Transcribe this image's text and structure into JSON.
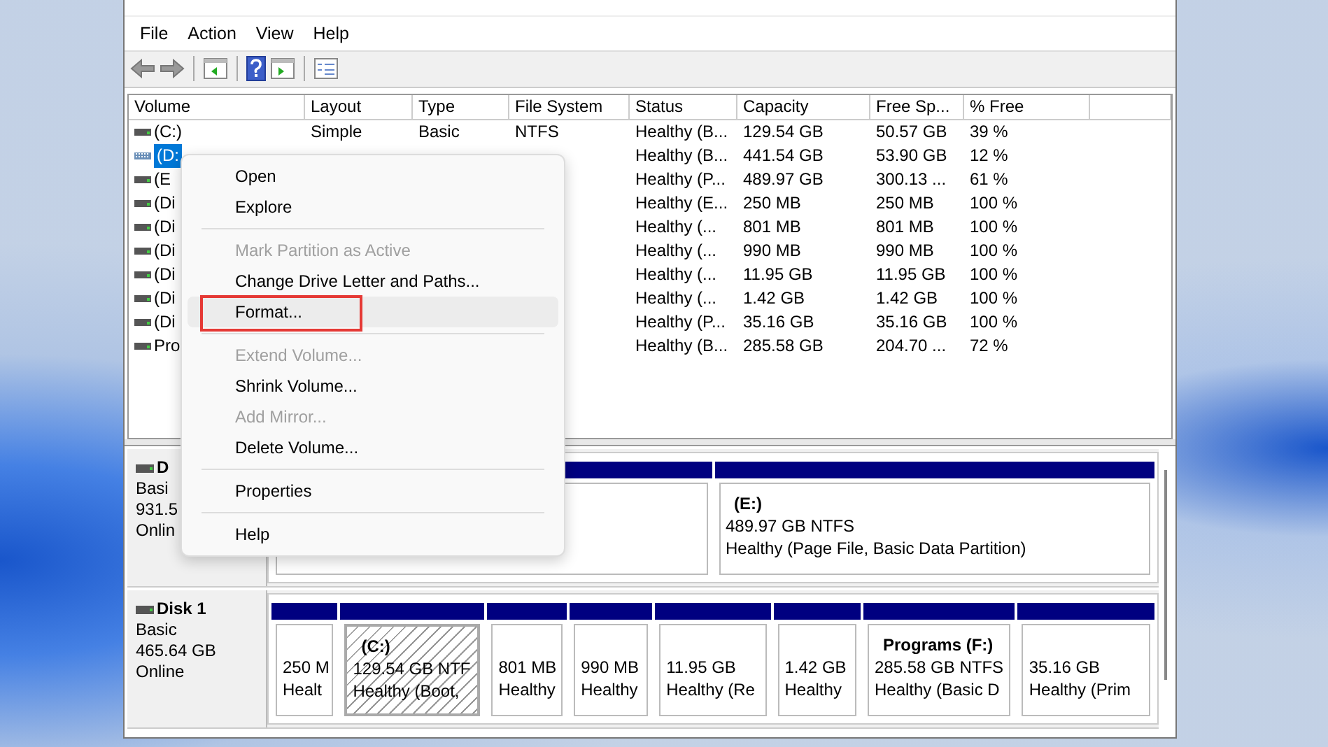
{
  "menu_bar": [
    "File",
    "Action",
    "View",
    "Help"
  ],
  "volume_list": {
    "columns": [
      "Volume",
      "Layout",
      "Type",
      "File System",
      "Status",
      "Capacity",
      "Free Sp...",
      "% Free"
    ],
    "rows": [
      {
        "selected": false,
        "cells": [
          "(C:)",
          "Simple",
          "Basic",
          "NTFS",
          "Healthy (B...",
          "129.54 GB",
          "50.57 GB",
          "39 %"
        ]
      },
      {
        "selected": true,
        "cells": [
          "(D:",
          "",
          "",
          "",
          "Healthy (B...",
          "441.54 GB",
          "53.90 GB",
          "12 %"
        ]
      },
      {
        "selected": false,
        "cells": [
          "(E",
          "",
          "",
          "",
          "Healthy (P...",
          "489.97 GB",
          "300.13 ...",
          "61 %"
        ]
      },
      {
        "selected": false,
        "cells": [
          "(Di",
          "",
          "",
          "",
          "Healthy (E...",
          "250 MB",
          "250 MB",
          "100 %"
        ]
      },
      {
        "selected": false,
        "cells": [
          "(Di",
          "",
          "",
          "",
          "Healthy (...",
          "801 MB",
          "801 MB",
          "100 %"
        ]
      },
      {
        "selected": false,
        "cells": [
          "(Di",
          "",
          "",
          "",
          "Healthy (...",
          "990 MB",
          "990 MB",
          "100 %"
        ]
      },
      {
        "selected": false,
        "cells": [
          "(Di",
          "",
          "",
          "",
          "Healthy (...",
          "11.95 GB",
          "11.95 GB",
          "100 %"
        ]
      },
      {
        "selected": false,
        "cells": [
          "(Di",
          "",
          "",
          "",
          "Healthy (...",
          "1.42 GB",
          "1.42 GB",
          "100 %"
        ]
      },
      {
        "selected": false,
        "cells": [
          "(Di",
          "",
          "",
          "",
          "Healthy (P...",
          "35.16 GB",
          "35.16 GB",
          "100 %"
        ]
      },
      {
        "selected": false,
        "cells": [
          "Pro",
          "",
          "",
          "",
          "Healthy (B...",
          "285.58 GB",
          "204.70 ...",
          "72 %"
        ]
      }
    ]
  },
  "context_menu": [
    {
      "kind": "item",
      "label": "Open",
      "disabled": false,
      "hovered": false,
      "outlined": false
    },
    {
      "kind": "item",
      "label": "Explore",
      "disabled": false,
      "hovered": false,
      "outlined": false
    },
    {
      "kind": "separator"
    },
    {
      "kind": "item",
      "label": "Mark Partition as Active",
      "disabled": true,
      "hovered": false,
      "outlined": false
    },
    {
      "kind": "item",
      "label": "Change Drive Letter and Paths...",
      "disabled": false,
      "hovered": false,
      "outlined": false
    },
    {
      "kind": "item",
      "label": "Format...",
      "disabled": false,
      "hovered": true,
      "outlined": true
    },
    {
      "kind": "separator"
    },
    {
      "kind": "item",
      "label": "Extend Volume...",
      "disabled": true,
      "hovered": false,
      "outlined": false
    },
    {
      "kind": "item",
      "label": "Shrink Volume...",
      "disabled": false,
      "hovered": false,
      "outlined": false
    },
    {
      "kind": "item",
      "label": "Add Mirror...",
      "disabled": true,
      "hovered": false,
      "outlined": false
    },
    {
      "kind": "item",
      "label": "Delete Volume...",
      "disabled": false,
      "hovered": false,
      "outlined": false
    },
    {
      "kind": "separator"
    },
    {
      "kind": "item",
      "label": "Properties",
      "disabled": false,
      "hovered": false,
      "outlined": false
    },
    {
      "kind": "separator"
    },
    {
      "kind": "item",
      "label": "Help",
      "disabled": false,
      "hovered": false,
      "outlined": false
    }
  ],
  "disks": [
    {
      "name": "D",
      "type": "Basi",
      "size": "931.5",
      "status": "Onlin",
      "partitions": [
        {
          "selected": false
        },
        {
          "selected": false,
          "label": "(E:)",
          "size": "489.97 GB NTFS",
          "health": "Healthy (Page File, Basic Data Partition)"
        }
      ]
    },
    {
      "name": "Disk 1",
      "type": "Basic",
      "size": "465.64 GB",
      "status": "Online",
      "partitions": [
        {
          "selected": false,
          "size": "250 M",
          "health": "Healt"
        },
        {
          "selected": true,
          "label": "(C:)",
          "size": "129.54 GB NTF",
          "health": "Healthy (Boot,"
        },
        {
          "selected": false,
          "size": "801 MB",
          "health": "Healthy"
        },
        {
          "selected": false,
          "size": "990 MB",
          "health": "Healthy"
        },
        {
          "selected": false,
          "size": "11.95 GB",
          "health": "Healthy (Re"
        },
        {
          "selected": false,
          "size": "1.42 GB",
          "health": "Healthy"
        },
        {
          "selected": false,
          "label": "Programs  (F:)",
          "size": "285.58 GB NTFS",
          "health": "Healthy (Basic D"
        },
        {
          "selected": false,
          "size": "35.16 GB",
          "health": "Healthy (Prim"
        }
      ]
    }
  ]
}
